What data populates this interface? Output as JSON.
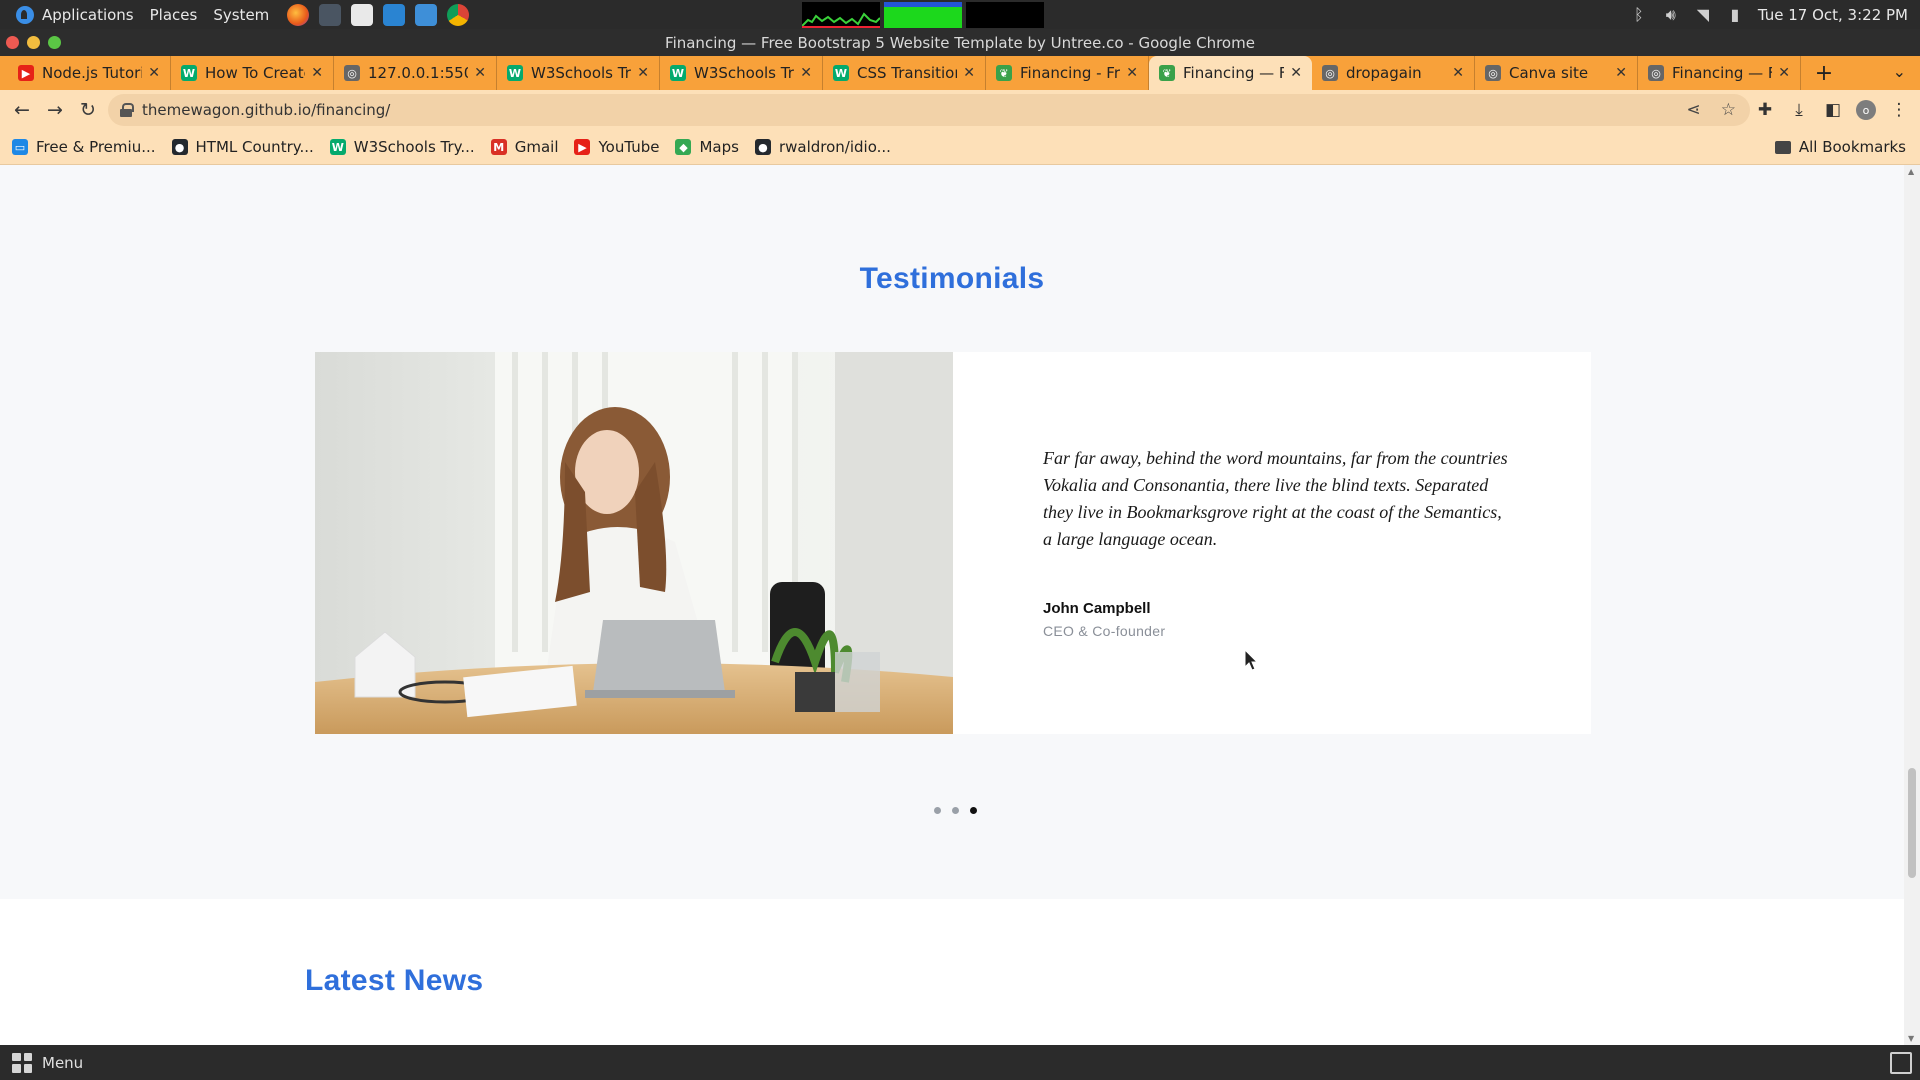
{
  "os_panel": {
    "menus": [
      "Applications",
      "Places",
      "System"
    ],
    "clock": "Tue 17 Oct,  3:22 PM",
    "launchers": [
      "firefox-launcher",
      "terminal-launcher",
      "editor-launcher",
      "vscode-launcher",
      "cloud-launcher",
      "chrome-launcher"
    ]
  },
  "window": {
    "title": "Financing — Free Bootstrap 5 Website Template by Untree.co - Google Chrome"
  },
  "tabs": [
    {
      "label": "Node.js Tutori",
      "favicon_color": "#e62117",
      "favicon_glyph": "▶"
    },
    {
      "label": "How To Create",
      "favicon_color": "#04aa6d",
      "favicon_glyph": "W"
    },
    {
      "label": "127.0.0.1:5500",
      "favicon_color": "#666666",
      "favicon_glyph": "◎"
    },
    {
      "label": "W3Schools Tr",
      "favicon_color": "#04aa6d",
      "favicon_glyph": "W"
    },
    {
      "label": "W3Schools Tr",
      "favicon_color": "#04aa6d",
      "favicon_glyph": "W"
    },
    {
      "label": "CSS Transition",
      "favicon_color": "#04aa6d",
      "favicon_glyph": "W"
    },
    {
      "label": "Financing - Fr",
      "favicon_color": "#3aa14a",
      "favicon_glyph": "❦"
    },
    {
      "label": "Financing — F",
      "favicon_color": "#3aa14a",
      "favicon_glyph": "❦",
      "active": true
    },
    {
      "label": "dropagain",
      "favicon_color": "#666666",
      "favicon_glyph": "◎"
    },
    {
      "label": "Canva site",
      "favicon_color": "#666666",
      "favicon_glyph": "◎"
    },
    {
      "label": "Financing — F",
      "favicon_color": "#666666",
      "favicon_glyph": "◎"
    }
  ],
  "toolbar": {
    "url": "themewagon.github.io/financing/"
  },
  "bookmarks": {
    "items": [
      {
        "label": "Free & Premiu...",
        "favicon_color": "#1e88e5",
        "favicon_glyph": "▭"
      },
      {
        "label": "HTML Country...",
        "favicon_color": "#24292e",
        "favicon_glyph": "●"
      },
      {
        "label": "W3Schools Try...",
        "favicon_color": "#04aa6d",
        "favicon_glyph": "W"
      },
      {
        "label": "Gmail",
        "favicon_color": "#d93025",
        "favicon_glyph": "M"
      },
      {
        "label": "YouTube",
        "favicon_color": "#e62117",
        "favicon_glyph": "▶"
      },
      {
        "label": "Maps",
        "favicon_color": "#34a853",
        "favicon_glyph": "◆"
      },
      {
        "label": "rwaldron/idio...",
        "favicon_color": "#24292e",
        "favicon_glyph": "●"
      }
    ],
    "all_label": "All Bookmarks"
  },
  "page": {
    "testimonials_title": "Testimonials",
    "testimonial": {
      "quote": "Far far away, behind the word mountains, far from the countries Vokalia and Consonantia, there live the blind texts. Separated they live in Bookmarksgrove right at the coast of the Semantics, a large language ocean.",
      "author": "John Campbell",
      "role": "CEO & Co-founder"
    },
    "carousel": {
      "count": 3,
      "active_index": 2
    },
    "news_title": "Latest News"
  },
  "taskbar": {
    "menu_label": "Menu"
  },
  "colors": {
    "accent": "#2f6fdb",
    "tabstrip": "#f8a13a",
    "toolbar": "#fde0b8"
  }
}
